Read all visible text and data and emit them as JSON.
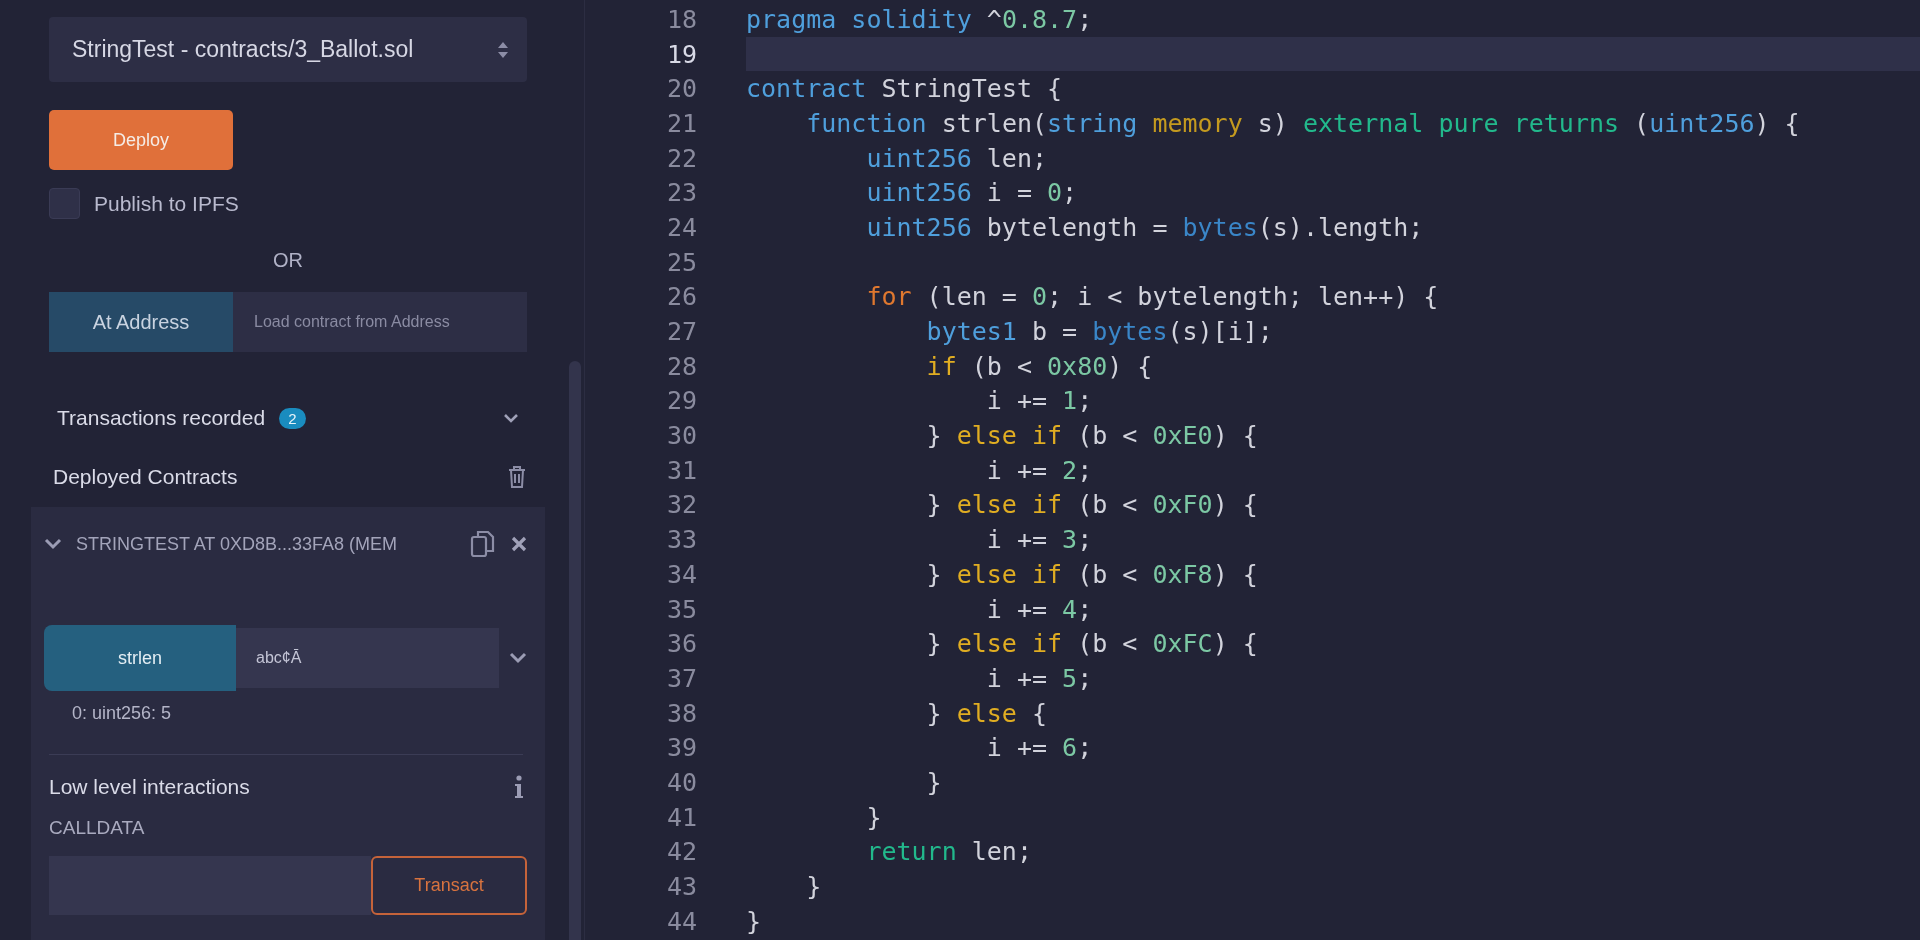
{
  "sidebar": {
    "contract_select": {
      "value": "StringTest - contracts/3_Ballot.sol"
    },
    "deploy_button": "Deploy",
    "publish_ipfs": {
      "label": "Publish to IPFS",
      "checked": false
    },
    "separator": "OR",
    "at_address": {
      "button": "At Address",
      "placeholder": "Load contract from Address"
    },
    "transactions": {
      "label": "Transactions recorded",
      "count": "2"
    },
    "deployed": {
      "label": "Deployed Contracts",
      "instance": {
        "title": "STRINGTEST AT 0XD8B...33FA8 (MEM",
        "expanded": true,
        "functions": [
          {
            "name": "strlen",
            "value": "abc¢Ā",
            "result": "0: uint256: 5"
          }
        ],
        "low_level": {
          "title": "Low level interactions",
          "calldata_label": "CALLDATA",
          "button": "Transact"
        }
      }
    }
  },
  "editor": {
    "lines": [
      {
        "n": "18",
        "selected": false,
        "tokens": [
          {
            "kind": "kw",
            "text": "pragma"
          },
          {
            "kind": "kw",
            "text": " solidity"
          },
          {
            "kind": "pl",
            "text": " ^"
          },
          {
            "kind": "num",
            "text": "0.8.7"
          },
          {
            "kind": "pl",
            "text": ";"
          }
        ]
      },
      {
        "n": "19",
        "selected": true
      },
      {
        "n": "20",
        "selected": false,
        "tokens": [
          {
            "kind": "kw",
            "text": "contract"
          },
          {
            "kind": "pl",
            "text": " StringTest {"
          }
        ],
        "children": [
          {
            "n": "21",
            "selected": false,
            "tokens": [
              {
                "kind": "kw",
                "text": "function"
              },
              {
                "kind": "pl",
                "text": " strlen("
              },
              {
                "kind": "kw",
                "text": "string"
              },
              {
                "kind": "st",
                "text": " memory"
              },
              {
                "kind": "pl",
                "text": " s) "
              },
              {
                "kind": "md",
                "text": "external"
              },
              {
                "kind": "md",
                "text": " pure"
              },
              {
                "kind": "md",
                "text": " returns"
              },
              {
                "kind": "pl",
                "text": " ("
              },
              {
                "kind": "kw",
                "text": "uint256"
              },
              {
                "kind": "pl",
                "text": ") {"
              }
            ],
            "children": [
              {
                "n": "22",
                "selected": false,
                "tokens": [
                  {
                    "kind": "kw",
                    "text": "uint256"
                  },
                  {
                    "kind": "pl",
                    "text": " len;"
                  }
                ]
              },
              {
                "n": "23",
                "selected": false,
                "tokens": [
                  {
                    "kind": "kw",
                    "text": "uint256"
                  },
                  {
                    "kind": "pl",
                    "text": " i = "
                  },
                  {
                    "kind": "num",
                    "text": "0"
                  },
                  {
                    "kind": "pl",
                    "text": ";"
                  }
                ]
              },
              {
                "n": "24",
                "selected": false,
                "tokens": [
                  {
                    "kind": "kw",
                    "text": "uint256"
                  },
                  {
                    "kind": "pl",
                    "text": " bytelength = "
                  },
                  {
                    "kind": "bi",
                    "text": "bytes"
                  },
                  {
                    "kind": "pl",
                    "text": "(s).length;"
                  }
                ]
              },
              {
                "n": "25",
                "selected": false
              },
              {
                "n": "26",
                "selected": false,
                "tokens": [
                  {
                    "kind": "ctl",
                    "text": "for"
                  },
                  {
                    "kind": "pl",
                    "text": " (len = "
                  },
                  {
                    "kind": "num",
                    "text": "0"
                  },
                  {
                    "kind": "pl",
                    "text": "; i < bytelength; len++) {"
                  }
                ],
                "children": [
                  {
                    "n": "27",
                    "selected": false,
                    "tokens": [
                      {
                        "kind": "kw",
                        "text": "bytes1"
                      },
                      {
                        "kind": "pl",
                        "text": " b = "
                      },
                      {
                        "kind": "bi",
                        "text": "bytes"
                      },
                      {
                        "kind": "pl",
                        "text": "(s)[i];"
                      }
                    ]
                  },
                  {
                    "n": "28",
                    "selected": false,
                    "tokens": [
                      {
                        "kind": "cond",
                        "text": "if"
                      },
                      {
                        "kind": "pl",
                        "text": " (b < "
                      },
                      {
                        "kind": "num",
                        "text": "0x80"
                      },
                      {
                        "kind": "pl",
                        "text": ") {"
                      }
                    ],
                    "children": [
                      {
                        "n": "29",
                        "selected": false,
                        "tokens": [
                          {
                            "kind": "pl",
                            "text": "i += "
                          },
                          {
                            "kind": "num",
                            "text": "1"
                          },
                          {
                            "kind": "pl",
                            "text": ";"
                          }
                        ]
                      }
                    ]
                  },
                  {
                    "n": "30",
                    "selected": false,
                    "tokens": [
                      {
                        "kind": "pl",
                        "text": "} "
                      },
                      {
                        "kind": "cond",
                        "text": "else"
                      },
                      {
                        "kind": "cond",
                        "text": " if"
                      },
                      {
                        "kind": "pl",
                        "text": " (b < "
                      },
                      {
                        "kind": "num",
                        "text": "0xE0"
                      },
                      {
                        "kind": "pl",
                        "text": ") {"
                      }
                    ],
                    "children": [
                      {
                        "n": "31",
                        "selected": false,
                        "tokens": [
                          {
                            "kind": "pl",
                            "text": "i += "
                          },
                          {
                            "kind": "num",
                            "text": "2"
                          },
                          {
                            "kind": "pl",
                            "text": ";"
                          }
                        ]
                      }
                    ]
                  },
                  {
                    "n": "32",
                    "selected": false,
                    "tokens": [
                      {
                        "kind": "pl",
                        "text": "} "
                      },
                      {
                        "kind": "cond",
                        "text": "else"
                      },
                      {
                        "kind": "cond",
                        "text": " if"
                      },
                      {
                        "kind": "pl",
                        "text": " (b < "
                      },
                      {
                        "kind": "num",
                        "text": "0xF0"
                      },
                      {
                        "kind": "pl",
                        "text": ") {"
                      }
                    ],
                    "children": [
                      {
                        "n": "33",
                        "selected": false,
                        "tokens": [
                          {
                            "kind": "pl",
                            "text": "i += "
                          },
                          {
                            "kind": "num",
                            "text": "3"
                          },
                          {
                            "kind": "pl",
                            "text": ";"
                          }
                        ]
                      }
                    ]
                  },
                  {
                    "n": "34",
                    "selected": false,
                    "tokens": [
                      {
                        "kind": "pl",
                        "text": "} "
                      },
                      {
                        "kind": "cond",
                        "text": "else"
                      },
                      {
                        "kind": "cond",
                        "text": " if"
                      },
                      {
                        "kind": "pl",
                        "text": " (b < "
                      },
                      {
                        "kind": "num",
                        "text": "0xF8"
                      },
                      {
                        "kind": "pl",
                        "text": ") {"
                      }
                    ],
                    "children": [
                      {
                        "n": "35",
                        "selected": false,
                        "tokens": [
                          {
                            "kind": "pl",
                            "text": "i += "
                          },
                          {
                            "kind": "num",
                            "text": "4"
                          },
                          {
                            "kind": "pl",
                            "text": ";"
                          }
                        ]
                      }
                    ]
                  },
                  {
                    "n": "36",
                    "selected": false,
                    "tokens": [
                      {
                        "kind": "pl",
                        "text": "} "
                      },
                      {
                        "kind": "cond",
                        "text": "else"
                      },
                      {
                        "kind": "cond",
                        "text": " if"
                      },
                      {
                        "kind": "pl",
                        "text": " (b < "
                      },
                      {
                        "kind": "num",
                        "text": "0xFC"
                      },
                      {
                        "kind": "pl",
                        "text": ") {"
                      }
                    ],
                    "children": [
                      {
                        "n": "37",
                        "selected": false,
                        "tokens": [
                          {
                            "kind": "pl",
                            "text": "i += "
                          },
                          {
                            "kind": "num",
                            "text": "5"
                          },
                          {
                            "kind": "pl",
                            "text": ";"
                          }
                        ]
                      }
                    ]
                  },
                  {
                    "n": "38",
                    "selected": false,
                    "tokens": [
                      {
                        "kind": "pl",
                        "text": "} "
                      },
                      {
                        "kind": "cond",
                        "text": "else"
                      },
                      {
                        "kind": "pl",
                        "text": " {"
                      }
                    ],
                    "children": [
                      {
                        "n": "39",
                        "selected": false,
                        "tokens": [
                          {
                            "kind": "pl",
                            "text": "i += "
                          },
                          {
                            "kind": "num",
                            "text": "6"
                          },
                          {
                            "kind": "pl",
                            "text": ";"
                          }
                        ]
                      }
                    ]
                  },
                  {
                    "n": "40",
                    "selected": false,
                    "tokens": [
                      {
                        "kind": "pl",
                        "text": "}"
                      }
                    ]
                  }
                ]
              },
              {
                "n": "41",
                "selected": false,
                "tokens": [
                  {
                    "kind": "pl",
                    "text": "}"
                  }
                ]
              },
              {
                "n": "42",
                "selected": false,
                "tokens": [
                  {
                    "kind": "md",
                    "text": "return"
                  },
                  {
                    "kind": "pl",
                    "text": " len;"
                  }
                ]
              }
            ]
          },
          {
            "n": "43",
            "selected": false,
            "tokens": [
              {
                "kind": "pl",
                "text": "}"
              }
            ]
          }
        ]
      },
      {
        "n": "44",
        "selected": false,
        "tokens": [
          {
            "kind": "pl",
            "text": "}"
          }
        ]
      }
    ]
  }
}
